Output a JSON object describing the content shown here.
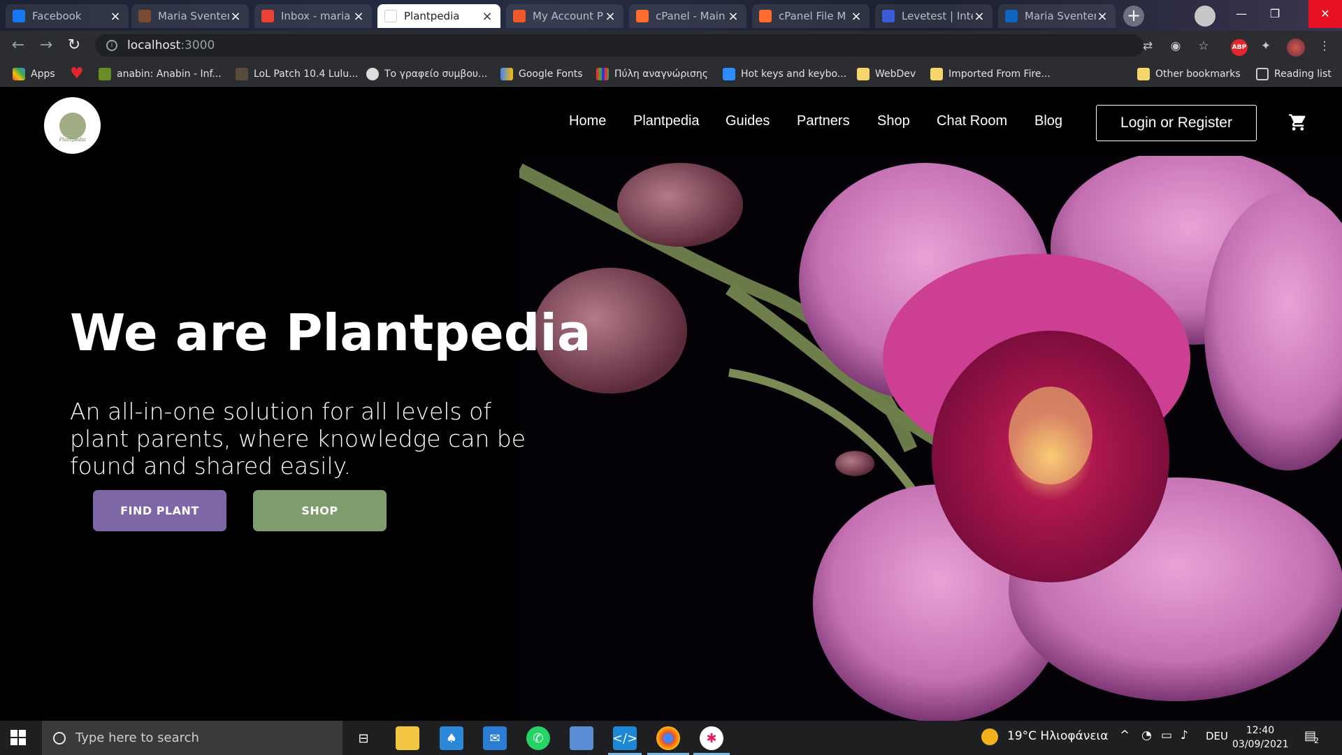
{
  "browser": {
    "tabs": [
      {
        "label": "Facebook",
        "icon": "facebook-icon",
        "color": "#1877f2"
      },
      {
        "label": "Maria Sventeri",
        "icon": "profile-icon",
        "color": "#7a4b33"
      },
      {
        "label": "Inbox - maria",
        "icon": "gmail-icon",
        "color": "#ea4335"
      },
      {
        "label": "Plantpedia",
        "icon": "page-icon",
        "color": "#ffffff"
      },
      {
        "label": "My Account P",
        "icon": "account-icon",
        "color": "#f05a28"
      },
      {
        "label": "cPanel - Main",
        "icon": "cpanel-icon",
        "color": "#ff6c2c"
      },
      {
        "label": "cPanel File M",
        "icon": "cpanel-icon",
        "color": "#ff6c2c"
      },
      {
        "label": "Levetest | Inte",
        "icon": "leve-icon",
        "color": "#3b5bdb"
      },
      {
        "label": "Maria Sventeri",
        "icon": "linkedin-icon",
        "color": "#0a66c2"
      }
    ],
    "active_tab": 3,
    "new_tab": "+",
    "url_host": "localhost",
    "url_port": ":3000",
    "bookmarks": [
      {
        "label": "Apps",
        "icon": "apps-grid-icon"
      },
      {
        "label": "",
        "icon": "heart-icon"
      },
      {
        "label": "anabin: Anabin - Inf...",
        "icon": "anabin-icon"
      },
      {
        "label": "LoL Patch 10.4 Lulu...",
        "icon": "lol-icon"
      },
      {
        "label": "Το γραφείο συμβου...",
        "icon": "globe-icon"
      },
      {
        "label": "Google Fonts",
        "icon": "google-fonts-icon"
      },
      {
        "label": "Πύλη αναγνώρισης",
        "icon": "grid-color-icon"
      },
      {
        "label": "Hot keys and keybo...",
        "icon": "zoom-icon"
      },
      {
        "label": "WebDev",
        "icon": "folder-icon"
      },
      {
        "label": "Imported From Fire...",
        "icon": "folder-icon"
      },
      {
        "label": "Other bookmarks",
        "icon": "folder-icon"
      },
      {
        "label": "Reading list",
        "icon": "reading-list-icon"
      }
    ]
  },
  "site": {
    "logo_text": "Plantpedia",
    "nav": [
      "Home",
      "Plantpedia",
      "Guides",
      "Partners",
      "Shop",
      "Chat Room",
      "Blog"
    ],
    "login_label": "Login or Register",
    "headline": "We are Plantpedia",
    "subline": "An all-in-one solution for all levels of plant parents, where knowledge can be found and shared easily.",
    "find_plant_label": "FIND PLANT",
    "shop_label": "SHOP",
    "colors": {
      "find": "#7d67a6",
      "shop": "#7f9c6d",
      "background": "#000000"
    }
  },
  "taskbar": {
    "search_placeholder": "Type here to search",
    "weather": "19°C  Ηλιοφάνεια",
    "language": "DEU",
    "time": "12:40",
    "date": "03/09/2021",
    "notification_count": "2"
  }
}
